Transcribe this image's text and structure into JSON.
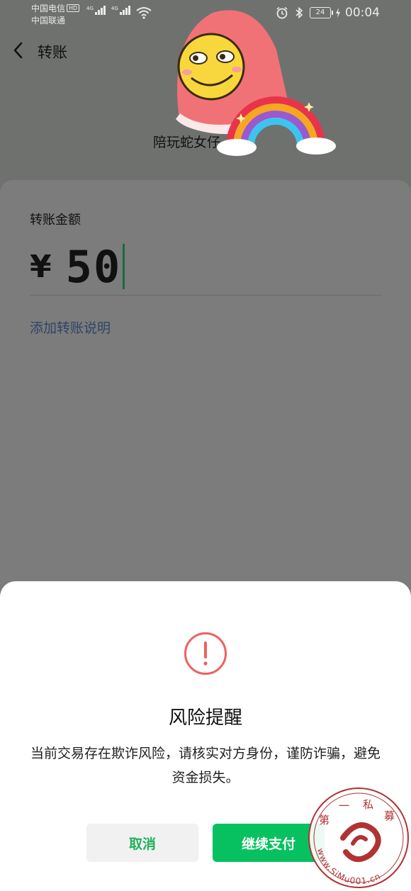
{
  "status_bar": {
    "carrier_1": "中国电信",
    "hd_badge": "HD",
    "carrier_2": "中国联通",
    "network_1": "4G",
    "network_2": "4G",
    "battery": "24",
    "time": "00:04"
  },
  "header": {
    "title": "转账"
  },
  "recipient": {
    "name": "陪玩蛇女仔"
  },
  "transfer": {
    "amount_label": "转账金额",
    "currency_symbol": "¥",
    "amount": "50",
    "add_note_label": "添加转账说明"
  },
  "dialog": {
    "title": "风险提醒",
    "message": "当前交易存在欺诈风险，请核实对方身份，谨防诈骗，避免资金损失。",
    "cancel_label": "取消",
    "continue_label": "继续支付"
  },
  "watermark": {
    "chars": [
      "第",
      "一",
      "私",
      "募"
    ],
    "url": "www.SiMu001.cn"
  },
  "colors": {
    "overlay_bg": "#6f716f",
    "card_bg": "#7b7c7b",
    "accent_green": "#07c160",
    "warning_red": "#f0605f",
    "watermark_red": "#b03232",
    "link_blue": "#2f4567"
  },
  "icons": [
    "back-arrow-icon",
    "alarm-icon",
    "bluetooth-icon",
    "battery-icon",
    "charge-icon",
    "wifi-icon",
    "warning-icon",
    "signal-icon"
  ]
}
